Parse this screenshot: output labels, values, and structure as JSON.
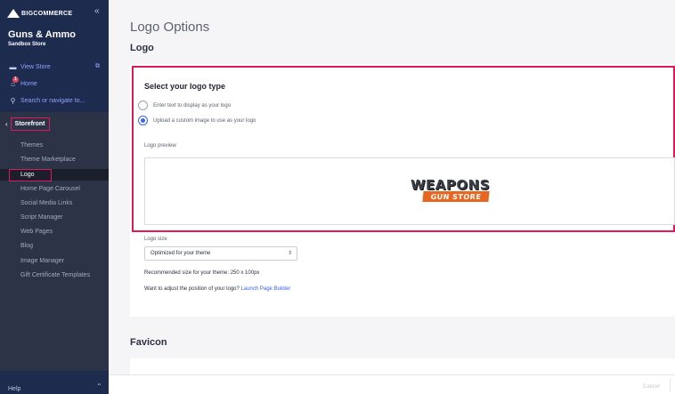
{
  "sidebar": {
    "brand": "BIGCOMMERCE",
    "collapse_glyph": "«",
    "store_name": "Guns & Ammo",
    "store_subtitle": "Sandbox Store",
    "view_store": "View Store",
    "home": "Home",
    "home_badge": "1",
    "search": "Search or navigate to...",
    "section": "Storefront",
    "items": [
      {
        "label": "Themes"
      },
      {
        "label": "Theme Marketplace"
      },
      {
        "label": "Logo",
        "active": true
      },
      {
        "label": "Home Page Carousel"
      },
      {
        "label": "Social Media Links"
      },
      {
        "label": "Script Manager"
      },
      {
        "label": "Web Pages"
      },
      {
        "label": "Blog"
      },
      {
        "label": "Image Manager"
      },
      {
        "label": "Gift Certificate Templates"
      }
    ],
    "help": "Help"
  },
  "main": {
    "page_title": "Logo Options",
    "section_title": "Logo",
    "card_heading": "Select your logo type",
    "options": [
      {
        "label": "Enter text to display as your logo",
        "checked": false
      },
      {
        "label": "Upload a custom image to use as your logo",
        "checked": true
      }
    ],
    "preview_label": "Logo preview",
    "logo_text_top": "WEAPONS",
    "logo_text_bottom": "GUN STORE",
    "size_label": "Logo size",
    "size_value": "Optimized for your theme",
    "recommended": "Recommended size for your theme: 250 x 100px",
    "adjust_text": "Want to adjust the position of your logo?",
    "adjust_link": "Launch Page Builder",
    "favicon_title": "Favicon"
  },
  "footer": {
    "cancel": "Cancel"
  },
  "colors": {
    "sidebar_bg": "#1d2b4f",
    "subnav_bg": "#2d3346",
    "highlight": "#e01a5a",
    "accent": "#3c64f4",
    "logo_orange": "#e8661f"
  }
}
